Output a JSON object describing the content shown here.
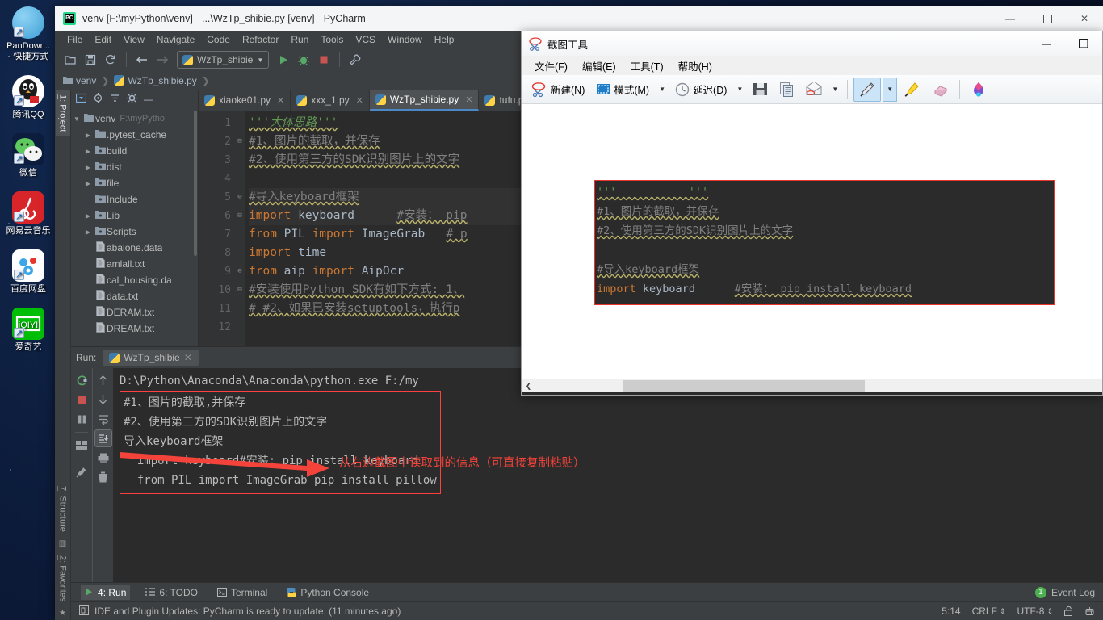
{
  "desktop": {
    "icons": [
      {
        "name": "pandownload",
        "label1": "PanDown..",
        "label2": "- 快捷方式",
        "glyph": "cloud-icon"
      },
      {
        "name": "tencent-qq",
        "label1": "腾讯QQ",
        "label2": "",
        "glyph": "penguin-icon"
      },
      {
        "name": "wechat",
        "label1": "微信",
        "label2": "",
        "glyph": "wechat-icon"
      },
      {
        "name": "netease-music",
        "label1": "网易云音乐",
        "label2": "",
        "glyph": "music-note-icon"
      },
      {
        "name": "baidu-netdisk",
        "label1": "百度网盘",
        "label2": "",
        "glyph": "baidu-cloud-icon"
      },
      {
        "name": "iqiyi",
        "label1": "爱奇艺",
        "label2": "",
        "glyph": "iqiyi-icon"
      }
    ]
  },
  "pycharm": {
    "title": "venv [F:\\myPython\\venv] - ...\\WzTp_shibie.py [venv] - PyCharm",
    "logo_text": "PC",
    "window_controls": {
      "minimize": "—",
      "maximize": "▢",
      "close": "✕"
    },
    "menus": [
      {
        "pre": "F",
        "rest": "ile"
      },
      {
        "pre": "E",
        "rest": "dit"
      },
      {
        "pre": "V",
        "rest": "iew"
      },
      {
        "pre": "N",
        "rest": "avigate"
      },
      {
        "pre": "C",
        "rest": "ode"
      },
      {
        "pre": "R",
        "rest": "efactor"
      },
      {
        "pre": "R",
        "rest": "un"
      },
      {
        "pre": "T",
        "rest": "ools"
      },
      {
        "pre": "VCS",
        "rest": ""
      },
      {
        "pre": "W",
        "rest": "indow"
      },
      {
        "pre": "H",
        "rest": "elp"
      }
    ],
    "toolbar": {
      "open_icon": "folder-open-icon",
      "save_icon": "save-icon",
      "sync_icon": "refresh-icon",
      "back_icon": "arrow-left-icon",
      "forward_icon": "arrow-right-icon",
      "run_config": "WzTp_shibie",
      "run_icon": "run-triangle-icon",
      "debug_icon": "debug-bug-icon",
      "stop_icon": "stop-square-icon",
      "settings_icon": "wrench-icon"
    },
    "breadcrumb": [
      "venv",
      "WzTp_shibie.py"
    ],
    "vertical_tabs": [
      {
        "num": "1",
        "label": ": Project",
        "active": true
      },
      {
        "num": "7",
        "label": ": Structure",
        "active": false
      },
      {
        "num": "2",
        "label": ": Favorites",
        "active": false
      }
    ],
    "project_panel": {
      "header_icons": [
        "select-opened-file-icon",
        "locate-icon",
        "collapse-all-icon",
        "settings-gear-icon",
        "hide-icon"
      ],
      "tree": [
        {
          "indent": 0,
          "arrow": "▼",
          "icon": "folder-icon",
          "label": "venv",
          "sub": "F:\\myPytho"
        },
        {
          "indent": 1,
          "arrow": "▶",
          "icon": "folder-icon",
          "label": ".pytest_cache",
          "sub": ""
        },
        {
          "indent": 1,
          "arrow": "▶",
          "icon": "module-folder-icon",
          "label": "build",
          "sub": ""
        },
        {
          "indent": 1,
          "arrow": "▶",
          "icon": "module-folder-icon",
          "label": "dist",
          "sub": ""
        },
        {
          "indent": 1,
          "arrow": "▶",
          "icon": "module-folder-icon",
          "label": "file",
          "sub": ""
        },
        {
          "indent": 1,
          "arrow": "",
          "icon": "module-folder-icon",
          "label": "Include",
          "sub": ""
        },
        {
          "indent": 1,
          "arrow": "▶",
          "icon": "module-folder-icon",
          "label": "Lib",
          "sub": ""
        },
        {
          "indent": 1,
          "arrow": "▶",
          "icon": "module-folder-icon",
          "label": "Scripts",
          "sub": ""
        },
        {
          "indent": 1,
          "arrow": "",
          "icon": "file-icon",
          "label": "abalone.data",
          "sub": ""
        },
        {
          "indent": 1,
          "arrow": "",
          "icon": "file-icon",
          "label": "amlall.txt",
          "sub": ""
        },
        {
          "indent": 1,
          "arrow": "",
          "icon": "file-icon",
          "label": "cal_housing.da",
          "sub": ""
        },
        {
          "indent": 1,
          "arrow": "",
          "icon": "file-icon",
          "label": "data.txt",
          "sub": ""
        },
        {
          "indent": 1,
          "arrow": "",
          "icon": "file-icon",
          "label": "DERAM.txt",
          "sub": ""
        },
        {
          "indent": 1,
          "arrow": "",
          "icon": "file-icon",
          "label": "DREAM.txt",
          "sub": ""
        }
      ]
    },
    "editor_tabs": [
      {
        "label": "xiaoke01.py",
        "active": false,
        "close": "✕"
      },
      {
        "label": "xxx_1.py",
        "active": false,
        "close": "✕"
      },
      {
        "label": "WzTp_shibie.py",
        "active": true,
        "close": "✕"
      },
      {
        "label": "tufu.py",
        "active": false,
        "close": ""
      }
    ],
    "code": {
      "line_numbers": [
        "1",
        "2",
        "3",
        "4",
        "5",
        "6",
        "7",
        "8",
        "9",
        "10",
        "11",
        "12"
      ],
      "folds": [
        "",
        "⊟",
        "",
        "",
        "⊖",
        "⊟",
        "",
        "",
        "⊖",
        "⊟",
        "",
        ""
      ],
      "lines": [
        "'''大体思路'''",
        "#1、图片的截取，并保存",
        "#2、使用第三方的SDK识别图片上的文字",
        "",
        "#导入keyboard框架",
        "import keyboard      #安装： pip",
        "from PIL import ImageGrab   # p",
        "import time",
        "from aip import AipOcr",
        "#安装使用Python SDK有如下方式: 1、",
        "# #2、如果已安装setuptools，执行p",
        ""
      ]
    },
    "run_panel": {
      "label": "Run:",
      "tab_label": "WzTp_shibie",
      "tab_close": "✕",
      "left_icons": [
        "rerun-icon",
        "stop-icon",
        "pause-icon",
        "layout-icon",
        "pin-icon"
      ],
      "right_icons": [
        "up-arrow-icon",
        "down-arrow-icon",
        "soft-wrap-icon",
        "scroll-to-end-icon",
        "print-icon",
        "trash-icon"
      ],
      "command_line": "D:\\Python\\Anaconda\\Anaconda\\python.exe F:/my",
      "output_lines": [
        "#1、图片的截取,并保存",
        "#2、使用第三方的SDK识别图片上的文字",
        "导入keyboard框架",
        "  import keyboard#安装: pip install keyboard",
        "  from PIL import ImageGrab pip install pillow"
      ],
      "annotation": "从右边截图中读取到的信息（可直接复制粘贴）",
      "annotation_color": "#f4433a",
      "box_color": "#ff4040"
    },
    "tool_window_bar": {
      "items": [
        {
          "num": "4",
          "label": ": Run",
          "icon": "run-triangle-icon",
          "active": true
        },
        {
          "num": "6",
          "label": ": TODO",
          "icon": "todo-list-icon",
          "active": false
        },
        {
          "num": "",
          "label": "Terminal",
          "icon": "terminal-icon",
          "active": false
        },
        {
          "num": "",
          "label": "Python Console",
          "icon": "python-icon",
          "active": false
        }
      ],
      "event_log": {
        "count": "1",
        "label": "Event Log"
      }
    },
    "status_bar": {
      "message_icon": "notification-icon",
      "message": "IDE and Plugin Updates: PyCharm is ready to update. (11 minutes ago)",
      "caret": "5:14",
      "line_sep": "CRLF",
      "encoding": "UTF-8",
      "lock_icon": "unlocked-padlock-icon",
      "inspection_icon": "inspector-robot-icon",
      "chevron": "⇕"
    }
  },
  "snipping_tool": {
    "title": "截图工具",
    "title_icon": "scissors-icon",
    "window_controls": {
      "minimize": "—",
      "maximize": "▢"
    },
    "menus": [
      "文件(F)",
      "编辑(E)",
      "工具(T)",
      "帮助(H)"
    ],
    "toolbar": [
      {
        "name": "new-snip-button",
        "label": "新建(N)",
        "icon": "scissors-icon",
        "dropdown": false,
        "selected": false
      },
      {
        "name": "mode-button",
        "label": "模式(M)",
        "icon": "selection-rect-icon",
        "dropdown": true,
        "selected": false
      },
      {
        "name": "delay-button",
        "label": "延迟(D)",
        "icon": "clock-icon",
        "dropdown": true,
        "selected": false
      },
      {
        "name": "save-button",
        "label": "",
        "icon": "floppy-save-icon",
        "dropdown": false,
        "selected": false
      },
      {
        "name": "copy-button",
        "label": "",
        "icon": "copy-pages-icon",
        "dropdown": false,
        "selected": false
      },
      {
        "name": "email-button",
        "label": "",
        "icon": "envelope-icon",
        "dropdown": true,
        "selected": false
      },
      {
        "name": "pen-button",
        "label": "",
        "icon": "pen-icon",
        "dropdown": true,
        "selected": true
      },
      {
        "name": "highlighter-button",
        "label": "",
        "icon": "highlighter-icon",
        "dropdown": false,
        "selected": false
      },
      {
        "name": "eraser-button",
        "label": "",
        "icon": "eraser-icon",
        "dropdown": false,
        "selected": false
      },
      {
        "name": "paint3d-button",
        "label": "",
        "icon": "paint-3d-icon",
        "dropdown": false,
        "selected": false
      }
    ],
    "captured_image": {
      "border_color": "#e8352c",
      "lines": [
        "'''           '''",
        "#1、图片的截取，并保存",
        "#2、使用第三方的SDK识别图片上的文字",
        "",
        "#导入keyboard框架",
        "import keyboard      #安装： pip install keyboard",
        "from PIL import ImageGrab   # pip install pillow"
      ]
    },
    "hscroll": {
      "left_arrow": "❮"
    }
  }
}
